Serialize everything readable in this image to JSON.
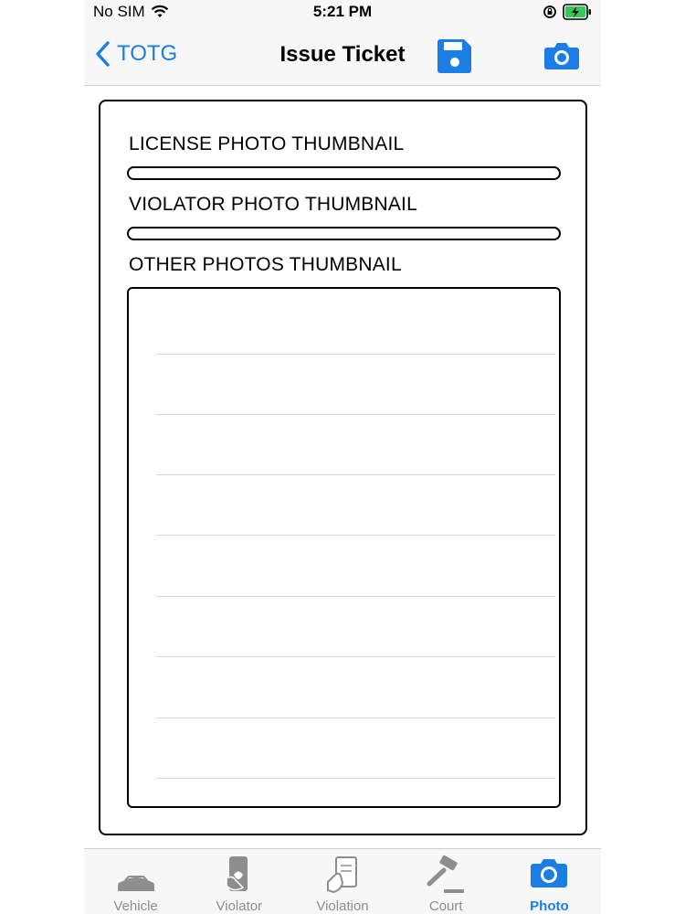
{
  "status_bar": {
    "carrier": "No SIM",
    "time": "5:21 PM"
  },
  "nav": {
    "back_label": "TOTG",
    "title": "Issue Ticket",
    "icons": [
      "chevron-left-icon",
      "save-icon",
      "camera-icon"
    ]
  },
  "sections": {
    "license_label": "LICENSE PHOTO THUMBNAIL",
    "violator_label": "VIOLATOR PHOTO THUMBNAIL",
    "other_label": "OTHER PHOTOS THUMBNAIL"
  },
  "tabs": [
    {
      "label": "Vehicle",
      "icon": "car-icon",
      "active": false
    },
    {
      "label": "Violator",
      "icon": "violator-icon",
      "active": false
    },
    {
      "label": "Violation",
      "icon": "violation-icon",
      "active": false
    },
    {
      "label": "Court",
      "icon": "gavel-icon",
      "active": false
    },
    {
      "label": "Photo",
      "icon": "camera-icon",
      "active": true
    }
  ],
  "colors": {
    "accent": "#1a7ee5",
    "inactive": "#8e8e8e"
  }
}
